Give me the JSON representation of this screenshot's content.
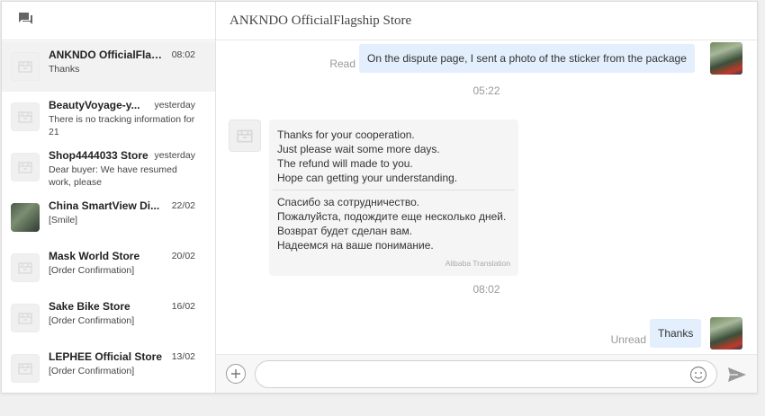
{
  "sidebar": {
    "conversations": [
      {
        "name": "ANKNDO OfficialFlagship Store",
        "time": "08:02",
        "preview": "Thanks"
      },
      {
        "name": "BeautyVoyage-y...",
        "time": "yesterday",
        "preview": "There is no tracking information for 21"
      },
      {
        "name": "Shop4444033 Store",
        "time": "yesterday",
        "preview": "Dear buyer: We have resumed work, please"
      },
      {
        "name": "China SmartView Di...",
        "time": "22/02",
        "preview": "[Smile]"
      },
      {
        "name": "Mask World Store",
        "time": "20/02",
        "preview": "[Order Confirmation]"
      },
      {
        "name": "Sake Bike Store",
        "time": "16/02",
        "preview": "[Order Confirmation]"
      },
      {
        "name": "LEPHEE Official Store",
        "time": "13/02",
        "preview": "[Order Confirmation]"
      }
    ]
  },
  "chat": {
    "title": "ANKNDO OfficialFlagship Store",
    "msg1": {
      "status": "Read",
      "text": "On the dispute page, I sent a photo of the sticker from the package"
    },
    "time1": "05:22",
    "msg2": {
      "lines": [
        "Thanks for your cooperation.",
        "Just please wait some more days.",
        "The refund will made to you.",
        "Hope can getting your understanding."
      ],
      "translation": [
        "Спасибо за сотрудничество.",
        "Пожалуйста, подождите еще несколько дней.",
        "Возврат будет сделан вам.",
        "Надеемся на ваше понимание."
      ],
      "credit": "Alibaba Translation"
    },
    "time2": "08:02",
    "msg3": {
      "status": "Unread",
      "text": "Thanks"
    }
  },
  "composer": {
    "placeholder": ""
  },
  "icons": {
    "chat": "chat-icon",
    "store": "store-icon",
    "plus": "plus-icon",
    "emoji": "emoji-icon",
    "send": "send-icon"
  },
  "colors": {
    "bubble_sent": "#e3effd",
    "bubble_received": "#f5f5f5",
    "active_row": "#f2f2f2"
  }
}
